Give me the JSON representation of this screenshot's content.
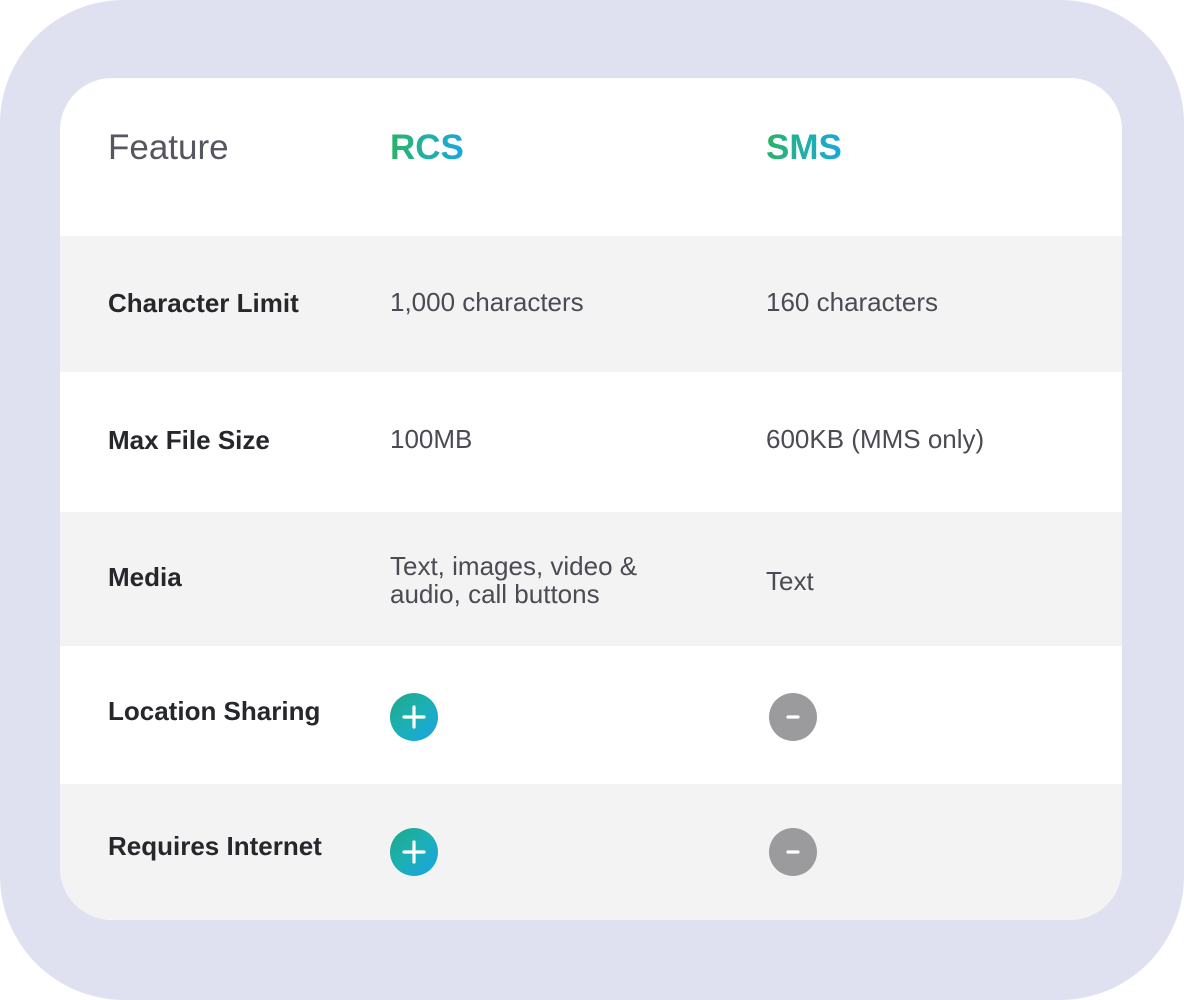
{
  "header": {
    "feature": "Feature",
    "rcs": "RCS",
    "sms": "SMS"
  },
  "rows": [
    {
      "feature": "Character Limit",
      "rcs": "1,000 characters",
      "sms": "160 characters"
    },
    {
      "feature": "Max File Size",
      "rcs": "100MB",
      "sms": "600KB (MMS only)"
    },
    {
      "feature": "Media",
      "rcs_line1": "Text, images, video &",
      "rcs_line2": "audio, call buttons",
      "sms": "Text"
    },
    {
      "feature": "Location Sharing",
      "rcs_icon": "plus-icon",
      "sms_icon": "minus-icon"
    },
    {
      "feature": "Requires Internet",
      "rcs_icon": "plus-icon",
      "sms_icon": "minus-icon"
    }
  ],
  "colors": {
    "outer_background": "#dfe1f1",
    "card_background": "#ffffff",
    "shaded_row": "#f3f3f4",
    "brand_gradient_start": "#2ab364",
    "brand_gradient_end": "#1aa7de",
    "minus_icon": "#9b9b9d"
  }
}
